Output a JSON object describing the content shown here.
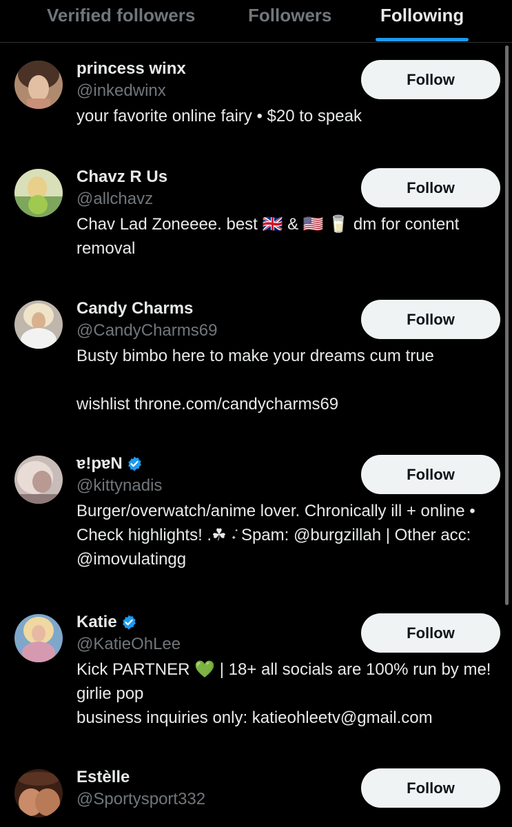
{
  "tabs": [
    {
      "label": "Verified followers",
      "active": false
    },
    {
      "label": "Followers",
      "active": false
    },
    {
      "label": "Following",
      "active": true
    }
  ],
  "accent_color": "#1d9bf0",
  "follow_label": "Follow",
  "accounts": [
    {
      "name": "princess winx",
      "handle": "@inkedwinx",
      "verified": false,
      "bio": "your favorite online fairy • $20 to speak"
    },
    {
      "name": "Chavz R Us",
      "handle": "@allchavz",
      "verified": false,
      "bio": "Chav Lad Zoneeee. best 🇬🇧 & 🇺🇸 🥛 dm for content removal"
    },
    {
      "name": "Candy Charms",
      "handle": "@CandyCharms69",
      "verified": false,
      "bio": "Busty bimbo here to make your dreams cum true\n\nwishlist throne.com/candycharms69"
    },
    {
      "name": "ɐ!pɐN",
      "handle": "@kittynadis",
      "verified": true,
      "bio": "Burger/overwatch/anime lover. Chronically ill + online • Check highlights! .☘︎ ݁˖ Spam: @burgzillah | Other acc: @imovulatingg"
    },
    {
      "name": "Katie",
      "handle": "@KatieOhLee",
      "verified": true,
      "bio": "Kick PARTNER 💚 | 18+ all socials are 100% run by me! girlie pop\nbusiness inquiries only: katieohleetv@gmail.com"
    },
    {
      "name": "Estèlle",
      "handle": "@Sportysport332",
      "verified": false,
      "bio": ""
    }
  ]
}
